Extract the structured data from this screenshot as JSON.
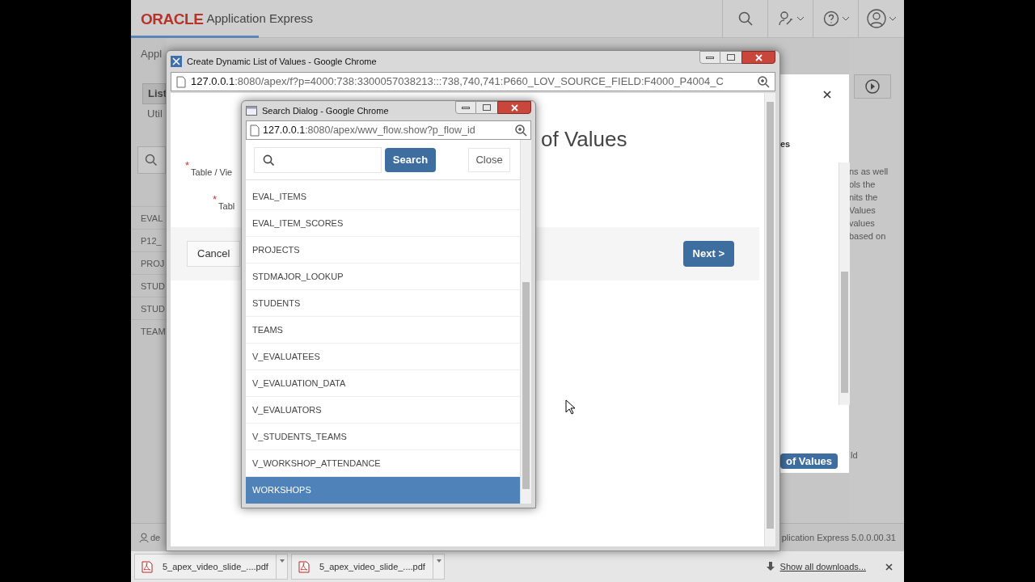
{
  "app_header": {
    "logo": "ORACLE",
    "product": "Application Express"
  },
  "background_left": {
    "tab": "Appl",
    "nav": [
      {
        "label": "List",
        "selected": true
      },
      {
        "label": "Util",
        "selected": false
      }
    ],
    "items": [
      "EVAL",
      "P12_",
      "PROJ",
      "STUD",
      "STUD",
      "TEAM"
    ]
  },
  "background_right": {
    "help_lines": [
      "ns as well",
      "ols the",
      "nits the",
      "Values",
      "values",
      "based on"
    ],
    "side_text": "ld",
    "version": "plication Express 5.0.0.00.31",
    "user": "de"
  },
  "lov_modal": {
    "heading_fragment": "es",
    "button": "of Values"
  },
  "wizard_window": {
    "title": "Create Dynamic List of Values - Google Chrome",
    "url_host": "127.0.0.1",
    "url_rest": ":8080/apex/f?p=4000:738:3300057038213:::738,740,741:P660_LOV_SOURCE_FIELD:F4000_P4004_C",
    "heading": "of Values",
    "fields": [
      {
        "marker": "*",
        "label": "Table / Vie"
      },
      {
        "marker": "*",
        "label": "Tabl"
      }
    ],
    "cancel": "Cancel",
    "next": "Next >"
  },
  "search_dialog": {
    "title": "Search Dialog - Google Chrome",
    "url_host": "127.0.0.1",
    "url_rest": ":8080/apex/wwv_flow.show?p_flow_id",
    "search_button": "Search",
    "close_button": "Close",
    "results": [
      {
        "label": "EVAL_ITEMS",
        "selected": false
      },
      {
        "label": "EVAL_ITEM_SCORES",
        "selected": false
      },
      {
        "label": "PROJECTS",
        "selected": false
      },
      {
        "label": "STDMAJOR_LOOKUP",
        "selected": false
      },
      {
        "label": "STUDENTS",
        "selected": false
      },
      {
        "label": "TEAMS",
        "selected": false
      },
      {
        "label": "V_EVALUATEES",
        "selected": false
      },
      {
        "label": "V_EVALUATION_DATA",
        "selected": false
      },
      {
        "label": "V_EVALUATORS",
        "selected": false
      },
      {
        "label": "V_STUDENTS_TEAMS",
        "selected": false
      },
      {
        "label": "V_WORKSHOP_ATTENDANCE",
        "selected": false
      },
      {
        "label": "WORKSHOPS",
        "selected": true
      }
    ]
  },
  "downloads": {
    "items": [
      "5_apex_video_slide_....pdf",
      "5_apex_video_slide_....pdf"
    ],
    "show_all": "Show all downloads..."
  }
}
